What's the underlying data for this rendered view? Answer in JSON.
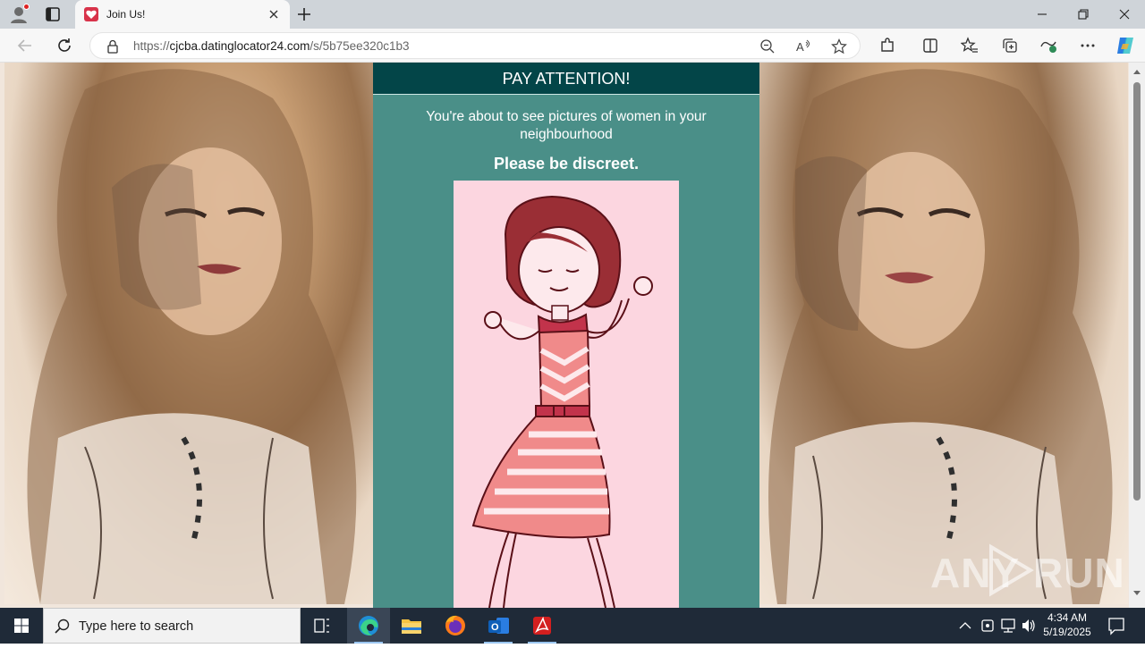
{
  "browser": {
    "tab_title": "Join Us!",
    "url_scheme": "https://",
    "url_host": "cjcba.datinglocator24.com",
    "url_path": "/s/5b75ee320c1b3"
  },
  "page": {
    "heading": "PAY ATTENTION!",
    "message": "You're about to see pictures of women in your neighbourhood",
    "discreet": "Please be discreet."
  },
  "watermark": {
    "left": "ANY",
    "right": "RUN"
  },
  "taskbar": {
    "search_placeholder": "Type here to search",
    "time": "4:34 AM",
    "date": "5/19/2025"
  },
  "colors": {
    "panel": "#4a8f88",
    "panel_head": "#034548",
    "card": "#fcd6e0",
    "favicon": "#d8334a"
  },
  "icons": [
    "profile-icon",
    "tab-actions-icon",
    "heart-icon",
    "close-icon",
    "plus-icon",
    "minimize-icon",
    "restore-icon",
    "back-icon",
    "refresh-icon",
    "lock-icon",
    "zoom-out-icon",
    "read-aloud-icon",
    "favorite-star-icon",
    "extensions-icon",
    "split-screen-icon",
    "favorites-icon",
    "collections-icon",
    "performance-icon",
    "more-icon",
    "copilot-icon",
    "windows-icon",
    "search-icon",
    "task-view-icon",
    "edge-icon",
    "file-explorer-icon",
    "firefox-icon",
    "outlook-icon",
    "acrobat-icon",
    "chevron-up-icon",
    "network-icon",
    "volume-icon",
    "notification-icon"
  ]
}
